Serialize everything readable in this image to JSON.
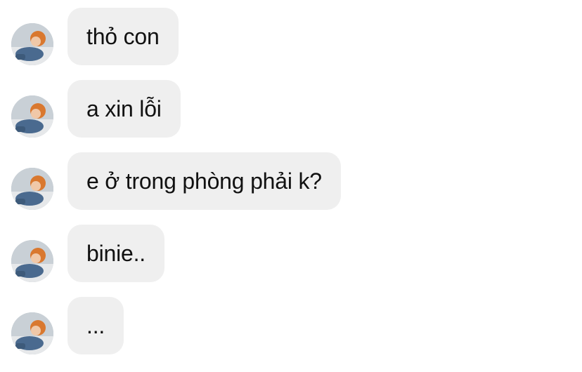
{
  "messages": [
    {
      "text": "thỏ con"
    },
    {
      "text": "a xin lỗi"
    },
    {
      "text": "e ở trong phòng phải k?"
    },
    {
      "text": "binie.."
    },
    {
      "text": "..."
    }
  ],
  "avatar_icon": "user-photo-avatar",
  "colors": {
    "bubble_background": "#efefef",
    "text": "#111111",
    "page_background": "#ffffff"
  }
}
